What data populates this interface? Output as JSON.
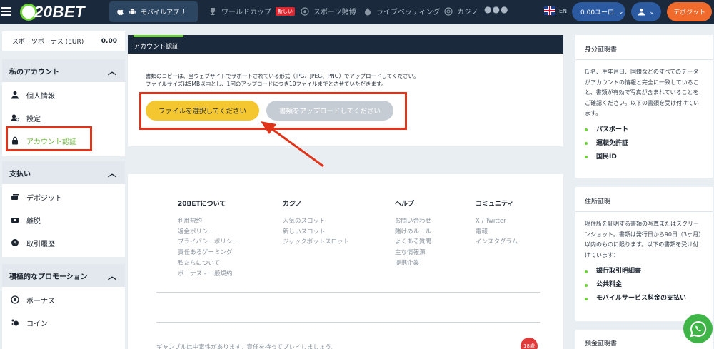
{
  "header": {
    "logo_text": "20BET",
    "mobile_app_label": "モバイルアプリ",
    "nav": [
      {
        "label": "ワールドカップ",
        "badge": "新しい"
      },
      {
        "label": "スポーツ賭博"
      },
      {
        "label": "ライブベッティング"
      },
      {
        "label": "カジノ"
      }
    ],
    "more_label": "●●●",
    "language": "EN",
    "balance": "0.00ユーロ",
    "deposit_label": "デポジット"
  },
  "sidebar": {
    "bonus": {
      "label": "スポーツボーナス (EUR)",
      "value": "0.00"
    },
    "account": {
      "title": "私のアカウント",
      "items": [
        {
          "label": "個人情報",
          "icon": "person-icon"
        },
        {
          "label": "設定",
          "icon": "settings-icon"
        },
        {
          "label": "アカウント認証",
          "icon": "lock-icon",
          "active": true
        }
      ]
    },
    "payments": {
      "title": "支払い",
      "items": [
        {
          "label": "デポジット",
          "icon": "deposit-icon"
        },
        {
          "label": "離脱",
          "icon": "withdraw-icon"
        },
        {
          "label": "取引履歴",
          "icon": "history-icon"
        }
      ]
    },
    "promotions": {
      "title": "積極的なプロモーション",
      "items": [
        {
          "label": "ボーナス",
          "icon": "bonus-icon"
        },
        {
          "label": "コイン",
          "icon": "coin-icon"
        }
      ]
    }
  },
  "verification": {
    "title": "アカウント認証",
    "desc_line1": "書類のコピーは、当ウェブサイトでサポートされている形式（JPG、JPEG、PNG）でアップロードしてください。",
    "desc_line2": "ファイルサイズは5MB以内とし、1回のアップロードにつき10ファイルまでとさせていただきます。",
    "choose_label": "ファイルを選択してください",
    "upload_label": "書類をアップロードしてください"
  },
  "footer": {
    "columns": [
      {
        "title": "20BETについて",
        "links": [
          "利用規約",
          "返金ポリシー",
          "プライバシーポリシー",
          "責任あるゲーミング",
          "私たちについて",
          "ボーナス - 一般規約"
        ]
      },
      {
        "title": "カジノ",
        "links": [
          "人気のスロット",
          "新しいスロット",
          "ジャックポットスロット"
        ]
      },
      {
        "title": "ヘルプ",
        "links": [
          "お問い合わせ",
          "賭けのルール",
          "よくある質問",
          "主な情報源",
          "提携企業"
        ]
      },
      {
        "title": "コミュニティ",
        "links": [
          "X / Twitter",
          "電報",
          "インスタグラム"
        ]
      }
    ],
    "gamble_text": "ギャンブルは中毒性があります。責任を持ってプレイしましょう。",
    "age_badge": "18歳"
  },
  "right_panel": {
    "identity": {
      "title": "身分証明書",
      "body": "氏名、生年月日、国籍などのすべてのデータがアカウントの情報と完全に一致していること、書類が有効で写真が含まれていることをご確認ください。以下の書類を受け付けています。",
      "items": [
        "パスポート",
        "運転免許証",
        "国民ID"
      ]
    },
    "address": {
      "title": "住所証明",
      "body": "現住所を証明する書類の写真またはスクリーンショット。書類は発行日から90日（3ヶ月）以内のものに限ります。以下の書類を受け付けています：",
      "items": [
        "銀行取引明細書",
        "公共料金",
        "モバイルサービス料金の支払い"
      ]
    },
    "next_title": "預金証明書"
  },
  "colors": {
    "topbar": "#1a2a3c",
    "accent_green": "#6bd338",
    "deposit_orange": "#f06a2b",
    "choose_yellow": "#f4c62f",
    "annotation_red": "#e0341a"
  }
}
